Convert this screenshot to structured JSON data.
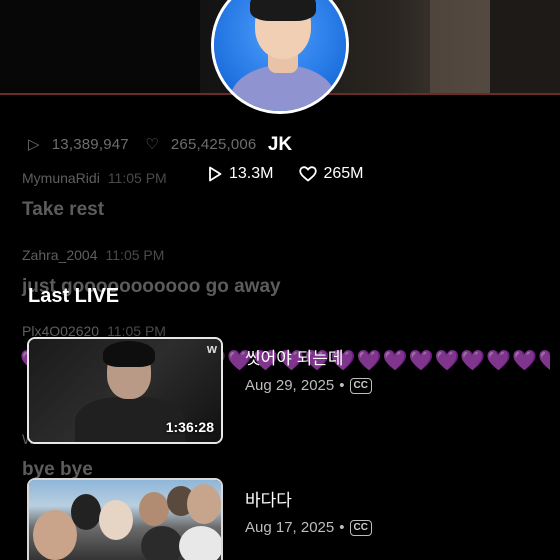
{
  "background_chat": {
    "stats": {
      "plays": "13,389,947",
      "likes": "265,425,006"
    },
    "messages": [
      {
        "user": "MymunaRidi",
        "time": "11:05 PM",
        "text": "Take rest"
      },
      {
        "user": "Zahra_2004",
        "time": "11:05 PM",
        "text": "just gooooooooooo go away"
      },
      {
        "user": "Plx4O02620",
        "time": "11:05 PM",
        "text": ""
      },
      {
        "user": "W",
        "time": "",
        "text": "bye bye"
      }
    ],
    "hearts": "💜💜💜💜💜💜💜💜💜💜💜💜💜💜💜💜💜💜💜💜💜"
  },
  "profile": {
    "name": "JK",
    "plays": "13.3M",
    "likes": "265M"
  },
  "section": {
    "title": "Last LIVE"
  },
  "lives": [
    {
      "title": "씻어야 되는데",
      "date": "Aug 29, 2025",
      "cc": "CC",
      "duration": "1:36:28",
      "badge": "w"
    },
    {
      "title": "바다다",
      "date": "Aug 17, 2025",
      "cc": "CC"
    }
  ],
  "colors": {
    "accent_line": "#6b2b2b",
    "text": "#ffffff",
    "muted": "#bdbdbd",
    "avatar_bg": "#2f7fe0"
  }
}
